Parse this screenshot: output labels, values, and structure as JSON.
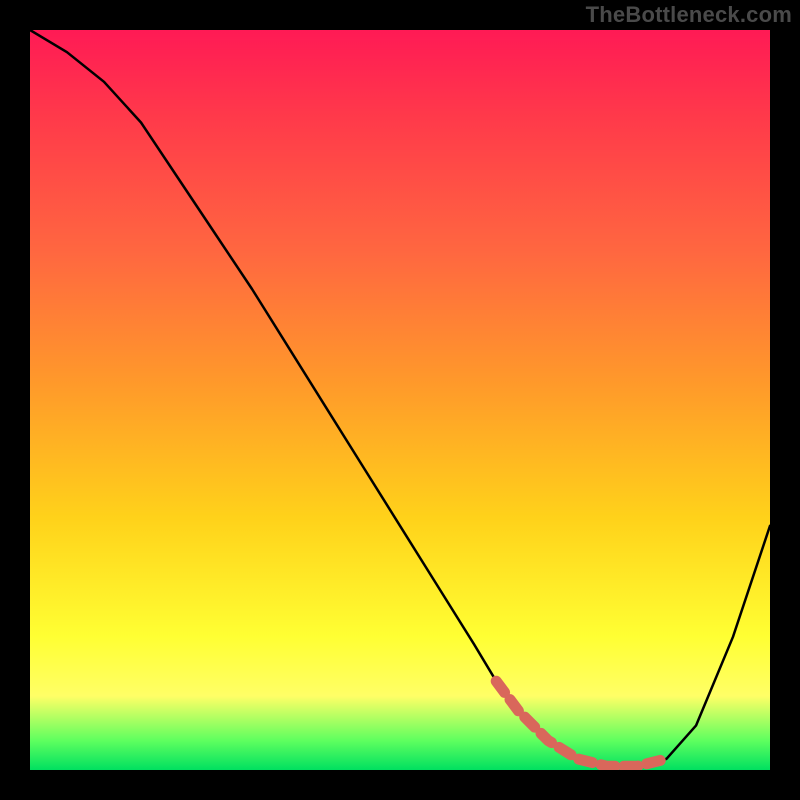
{
  "watermark": "TheBottleneck.com",
  "chart_data": {
    "type": "line",
    "title": "",
    "xlabel": "",
    "ylabel": "",
    "xlim": [
      0,
      100
    ],
    "ylim": [
      0,
      100
    ],
    "series": [
      {
        "name": "bottleneck-curve",
        "x": [
          0,
          5,
          10,
          15,
          20,
          25,
          30,
          35,
          40,
          45,
          50,
          55,
          60,
          63,
          66,
          70,
          74,
          78,
          82,
          86,
          90,
          95,
          100
        ],
        "y": [
          100,
          97,
          93,
          87.5,
          80,
          72.5,
          65,
          57,
          49,
          41,
          33,
          25,
          17,
          12,
          8,
          4,
          1.5,
          0.5,
          0.5,
          1.5,
          6,
          18,
          33
        ]
      },
      {
        "name": "optimal-band",
        "x": [
          63,
          66,
          70,
          74,
          78,
          82,
          86
        ],
        "y": [
          12,
          8,
          4,
          1.5,
          0.5,
          0.5,
          1.5
        ]
      }
    ],
    "colors": {
      "gradient_top": "#ff1a55",
      "gradient_mid": "#ffd21a",
      "gradient_bottom": "#00e060",
      "curve": "#000000",
      "optimal": "#d9675b"
    }
  }
}
